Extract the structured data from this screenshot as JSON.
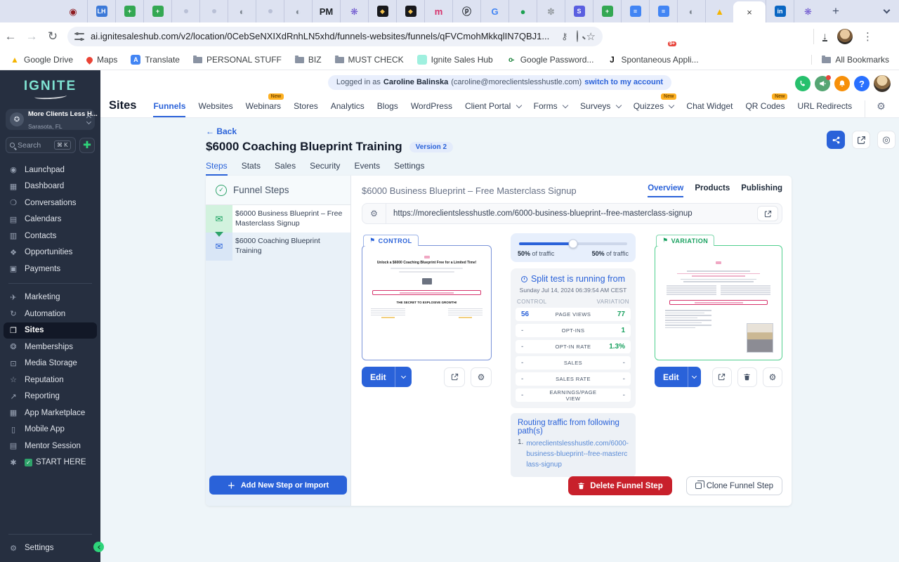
{
  "browser": {
    "url": "ai.ignitesaleshub.com/v2/location/0CebSeNXIXdRnhLN5xhd/funnels-websites/funnels/qFVCmohMkkqlIN7QBJ1...",
    "new_tab": "+",
    "tabs": [
      {
        "name": "record-tab",
        "kind": "txt",
        "glyph": "◉",
        "fg": "#8f1d22"
      },
      {
        "name": "leadhub-tab",
        "kind": "sq",
        "glyph": "LH",
        "bg": "#3c79d8"
      },
      {
        "name": "sheets-tab",
        "kind": "sq",
        "glyph": "+",
        "bg": "#34a853"
      },
      {
        "name": "sheets-tab",
        "kind": "sq",
        "glyph": "+",
        "bg": "#34a853"
      },
      {
        "name": "blank-tab",
        "kind": "dot",
        "glyph": ""
      },
      {
        "name": "blank-tab",
        "kind": "dot",
        "glyph": ""
      },
      {
        "name": "globe-tab",
        "kind": "txt",
        "glyph": "◐",
        "fg": "#7d8590"
      },
      {
        "name": "blank-tab",
        "kind": "dot",
        "glyph": ""
      },
      {
        "name": "globe-tab",
        "kind": "txt",
        "glyph": "◐",
        "fg": "#7d8590"
      },
      {
        "name": "pm-tab",
        "kind": "txt",
        "glyph": "PM",
        "fg": "#1f2328"
      },
      {
        "name": "snowflake-tab",
        "kind": "txt",
        "glyph": "❋",
        "fg": "#6e56cf"
      },
      {
        "name": "diamond-tab",
        "kind": "sq",
        "glyph": "◆",
        "bg": "#17181c",
        "fg": "#f2c14e"
      },
      {
        "name": "diamond-tab",
        "kind": "sq",
        "glyph": "◆",
        "bg": "#17181c",
        "fg": "#f2c14e"
      },
      {
        "name": "medium-tab",
        "kind": "txt",
        "glyph": "m",
        "fg": "#d6336c"
      },
      {
        "name": "spiral-tab",
        "kind": "txt",
        "glyph": "ⓟ",
        "fg": "#24292f"
      },
      {
        "name": "google-tab",
        "kind": "txt",
        "glyph": "G",
        "fg": "#4285f4"
      },
      {
        "name": "green-circle-tab",
        "kind": "txt",
        "glyph": "●",
        "fg": "#1da152"
      },
      {
        "name": "flower-tab",
        "kind": "txt",
        "glyph": "✽",
        "fg": "#9aa0a6"
      },
      {
        "name": "s-app-tab",
        "kind": "sq",
        "glyph": "S",
        "bg": "#5a5fe0"
      },
      {
        "name": "sheets-tab",
        "kind": "sq",
        "glyph": "+",
        "bg": "#34a853"
      },
      {
        "name": "docs-tab",
        "kind": "sq",
        "glyph": "≡",
        "bg": "#4285f4"
      },
      {
        "name": "docs-tab",
        "kind": "sq",
        "glyph": "≡",
        "bg": "#4285f4"
      },
      {
        "name": "globe-tab",
        "kind": "txt",
        "glyph": "◐",
        "fg": "#7d8590"
      },
      {
        "name": "drive-tab",
        "kind": "txt",
        "glyph": "▲",
        "fg": "#f4b400"
      },
      {
        "name": "active-tab",
        "kind": "active",
        "glyph": "×"
      },
      {
        "name": "linkedin-tab",
        "kind": "sq",
        "glyph": "in",
        "bg": "#0a66c2"
      },
      {
        "name": "snowflake-tab",
        "kind": "txt",
        "glyph": "❋",
        "fg": "#6e56cf"
      }
    ],
    "extensions": [
      {
        "name": "translate-extension-icon",
        "glyph": "A",
        "bg": "#4285f4",
        "fg": "#ffffff"
      },
      {
        "name": "red-grid-extension-icon",
        "glyph": "▤",
        "bg": "#d93025",
        "fg": "#ffffff"
      },
      {
        "name": "spark-extension-icon",
        "glyph": "❋",
        "bg": "transparent",
        "fg": "#7c5cff",
        "badge": "9+"
      },
      {
        "name": "leaf-extension-icon",
        "glyph": "◗",
        "bg": "transparent",
        "fg": "#34a853"
      },
      {
        "name": "1b-extension-icon",
        "glyph": "1b",
        "bg": "#9aa0a6",
        "fg": "#ffffff"
      },
      {
        "name": "brain-extension-icon",
        "glyph": "❊",
        "bg": "transparent",
        "fg": "#d459c8"
      },
      {
        "name": "wand-extension-icon",
        "glyph": "✎",
        "bg": "transparent",
        "fg": "#24292f"
      },
      {
        "name": "blue-o-extension-icon",
        "glyph": "o",
        "bg": "#2563eb",
        "fg": "#ffffff"
      },
      {
        "name": "puzzle-extensions-icon",
        "glyph": "❖",
        "bg": "transparent",
        "fg": "#5f6368"
      }
    ],
    "bookmarks": [
      {
        "name": "bookmark-google-drive",
        "label": "Google Drive",
        "kind": "drive",
        "glyph": "▲"
      },
      {
        "name": "bookmark-maps",
        "label": "Maps",
        "kind": "pin",
        "glyph": ""
      },
      {
        "name": "bookmark-translate",
        "label": "Translate",
        "kind": "translate",
        "glyph": "A"
      },
      {
        "name": "bookmark-personal-stuff",
        "label": "PERSONAL STUFF",
        "kind": "folder",
        "glyph": ""
      },
      {
        "name": "bookmark-biz",
        "label": "BIZ",
        "kind": "folder",
        "glyph": ""
      },
      {
        "name": "bookmark-must-check",
        "label": "MUST CHECK",
        "kind": "folder",
        "glyph": ""
      },
      {
        "name": "bookmark-ignite-sales-hub",
        "label": "Ignite Sales Hub",
        "kind": "tile",
        "glyph": ""
      },
      {
        "name": "bookmark-google-password",
        "label": "Google Password...",
        "kind": "key",
        "glyph": "o-"
      },
      {
        "name": "bookmark-spontaneous",
        "label": "Spontaneous Appli...",
        "kind": "letter",
        "glyph": "J"
      }
    ],
    "all_bookmarks": "All Bookmarks"
  },
  "app_header": {
    "logged_prefix": "Logged in as",
    "user_name": "Caroline Balinska",
    "user_email": "(caroline@moreclientslesshustle.com)",
    "switch_link": "switch to my account"
  },
  "nav": {
    "section": "Sites",
    "items": [
      {
        "name": "nav-funnels",
        "label": "Funnels",
        "active": true
      },
      {
        "name": "nav-websites",
        "label": "Websites"
      },
      {
        "name": "nav-webinars",
        "label": "Webinars",
        "badge": "New"
      },
      {
        "name": "nav-stores",
        "label": "Stores"
      },
      {
        "name": "nav-analytics",
        "label": "Analytics"
      },
      {
        "name": "nav-blogs",
        "label": "Blogs"
      },
      {
        "name": "nav-wordpress",
        "label": "WordPress"
      },
      {
        "name": "nav-client-portal",
        "label": "Client Portal",
        "caret": true
      },
      {
        "name": "nav-forms",
        "label": "Forms",
        "caret": true
      },
      {
        "name": "nav-surveys",
        "label": "Surveys",
        "caret": true
      },
      {
        "name": "nav-quizzes",
        "label": "Quizzes",
        "caret": true,
        "badge": "New"
      },
      {
        "name": "nav-chat-widget",
        "label": "Chat Widget"
      },
      {
        "name": "nav-qr-codes",
        "label": "QR Codes",
        "badge": "New"
      },
      {
        "name": "nav-url-redirects",
        "label": "URL Redirects"
      }
    ]
  },
  "sidebar": {
    "logo": "IGNITE",
    "account": {
      "name": "More Clients Less H...",
      "location": "Sarasota, FL"
    },
    "search_placeholder": "Search",
    "search_shortcut": "⌘ K",
    "items_top": [
      {
        "name": "sidebar-item-launchpad",
        "label": "Launchpad",
        "glyph": "◉"
      },
      {
        "name": "sidebar-item-dashboard",
        "label": "Dashboard",
        "glyph": "▦"
      },
      {
        "name": "sidebar-item-conversations",
        "label": "Conversations",
        "glyph": "❍"
      },
      {
        "name": "sidebar-item-calendars",
        "label": "Calendars",
        "glyph": "▤"
      },
      {
        "name": "sidebar-item-contacts",
        "label": "Contacts",
        "glyph": "▥"
      },
      {
        "name": "sidebar-item-opportunities",
        "label": "Opportunities",
        "glyph": "❖"
      },
      {
        "name": "sidebar-item-payments",
        "label": "Payments",
        "glyph": "▣"
      }
    ],
    "items_bottom": [
      {
        "name": "sidebar-item-marketing",
        "label": "Marketing",
        "glyph": "✈"
      },
      {
        "name": "sidebar-item-automation",
        "label": "Automation",
        "glyph": "↻"
      },
      {
        "name": "sidebar-item-sites",
        "label": "Sites",
        "glyph": "❐",
        "active": true
      },
      {
        "name": "sidebar-item-memberships",
        "label": "Memberships",
        "glyph": "❂"
      },
      {
        "name": "sidebar-item-media-storage",
        "label": "Media Storage",
        "glyph": "⊡"
      },
      {
        "name": "sidebar-item-reputation",
        "label": "Reputation",
        "glyph": "☆"
      },
      {
        "name": "sidebar-item-reporting",
        "label": "Reporting",
        "glyph": "↗"
      },
      {
        "name": "sidebar-item-app-marketplace",
        "label": "App Marketplace",
        "glyph": "▦"
      },
      {
        "name": "sidebar-item-mobile-app",
        "label": "Mobile App",
        "glyph": "▯"
      },
      {
        "name": "sidebar-item-mentor-session",
        "label": "Mentor Session",
        "glyph": "▤"
      },
      {
        "name": "sidebar-item-start-here",
        "label": "START HERE",
        "glyph": "✱",
        "check": true
      }
    ],
    "settings_label": "Settings"
  },
  "page": {
    "back_label": "Back",
    "title": "$6000 Coaching Blueprint Training",
    "version_badge": "Version 2",
    "tabs": [
      {
        "name": "tab-steps",
        "label": "Steps",
        "active": true
      },
      {
        "name": "tab-stats",
        "label": "Stats"
      },
      {
        "name": "tab-sales",
        "label": "Sales"
      },
      {
        "name": "tab-security",
        "label": "Security"
      },
      {
        "name": "tab-events",
        "label": "Events"
      },
      {
        "name": "tab-settings",
        "label": "Settings"
      }
    ]
  },
  "funnel": {
    "header": "Funnel Steps",
    "steps": [
      {
        "label": "$6000 Business Blueprint – Free Masterclass Signup"
      },
      {
        "label": "$6000 Coaching Blueprint Training"
      }
    ],
    "add_button": "Add New Step or Import"
  },
  "overview": {
    "step_title": "$6000 Business Blueprint – Free Masterclass Signup",
    "tabs": [
      {
        "name": "tab-overview",
        "label": "Overview",
        "active": true
      },
      {
        "name": "tab-products",
        "label": "Products"
      },
      {
        "name": "tab-publishing",
        "label": "Publishing"
      }
    ],
    "url": "https://moreclientslesshustle.com/6000-business-blueprint--free-masterclass-signup",
    "control_label": "CONTROL",
    "variation_label": "VARIATION",
    "edit_label": "Edit",
    "split": {
      "left_pct": "50%",
      "right_pct": "50%",
      "of_traffic": "of traffic",
      "running_title": "Split test is running from",
      "running_since": "Sunday Jul 14, 2024 06:39:54 AM CEST",
      "col_left": "CONTROL",
      "col_right": "VARIATION",
      "rows": [
        {
          "c": "56",
          "m": "PAGE VIEWS",
          "v": "77",
          "cb": true,
          "vg": true
        },
        {
          "c": "-",
          "m": "OPT-INS",
          "v": "1",
          "vg": true
        },
        {
          "c": "-",
          "m": "OPT-IN RATE",
          "v": "1.3%",
          "vg": true
        },
        {
          "c": "-",
          "m": "SALES",
          "v": "-"
        },
        {
          "c": "-",
          "m": "SALES RATE",
          "v": "-"
        },
        {
          "c": "-",
          "m": "EARNINGS/PAGE VIEW",
          "v": "-"
        }
      ]
    },
    "routing_title": "Routing traffic from following path(s)",
    "routing_index": "1.",
    "routing_path": "moreclientslesshustle.com/6000-business-blueprint--free-masterclass-signup",
    "delete_button": "Delete Funnel Step",
    "clone_button": "Clone Funnel Step"
  },
  "control_thumb": {
    "headline": "Unlock a $6000 Coaching Blueprint Free for a Limited Time!",
    "section_title": "THE SECRET TO EXPLOSIVE GROWTH!"
  },
  "colors": {
    "accent_blue": "#2a62d9",
    "green": "#17a05e",
    "red": "#c8202b",
    "sidebar_bg": "#262f40",
    "logo_teal": "#7fe3d2"
  }
}
